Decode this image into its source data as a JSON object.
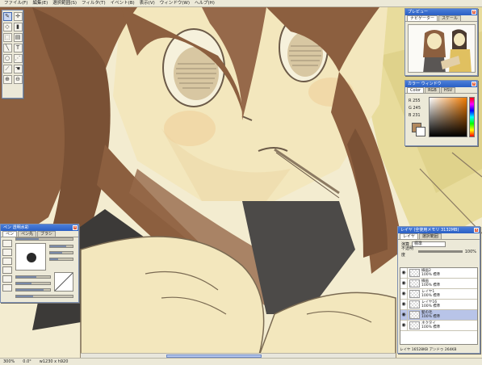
{
  "menu": {
    "items": [
      "ファイル(F)",
      "編集(E)",
      "選択範囲(S)",
      "フィルタ(T)",
      "イベント(B)",
      "表示(V)",
      "ウィンドウ(W)",
      "ヘルプ(H)"
    ]
  },
  "toolbox": {
    "tools": [
      {
        "name": "pen-tool-icon",
        "glyph": "✎"
      },
      {
        "name": "move-tool-icon",
        "glyph": "✛"
      },
      {
        "name": "eraser-tool-icon",
        "glyph": "◇"
      },
      {
        "name": "fill-tool-icon",
        "glyph": "▮"
      },
      {
        "name": "select-tool-icon",
        "glyph": "⬚"
      },
      {
        "name": "gradient-tool-icon",
        "glyph": "▤"
      },
      {
        "name": "line-tool-icon",
        "glyph": "╲"
      },
      {
        "name": "text-tool-icon",
        "glyph": "T"
      },
      {
        "name": "lasso-tool-icon",
        "glyph": "○"
      },
      {
        "name": "magic-wand-icon",
        "glyph": "⋰"
      },
      {
        "name": "eyedropper-icon",
        "glyph": "⟋"
      },
      {
        "name": "hand-tool-icon",
        "glyph": "☚"
      },
      {
        "name": "zoom-in-icon",
        "glyph": "⊕"
      },
      {
        "name": "zoom-out-icon",
        "glyph": "⊖"
      }
    ]
  },
  "preview": {
    "title": "プレビュー",
    "tabs": [
      "ナビゲーター",
      "スケール"
    ]
  },
  "color_window": {
    "title": "カラー ウィンドウ",
    "tabs": [
      "Color",
      "RGB",
      "HSV"
    ],
    "r_label": "R 255",
    "g_label": "G 245",
    "b_label": "B 231",
    "foreground": "#b2895e",
    "background": "#ffffff"
  },
  "pen_window": {
    "title": "ペン 透明水彩",
    "tabs": [
      "ペン",
      "ペン先",
      "ブラシ"
    ]
  },
  "layer_window": {
    "title": "レイヤ (全使用メモリ 3132MB)",
    "tabs": [
      "レイヤ",
      "選択範囲"
    ],
    "mode_label": "演算",
    "mode_value": "標準",
    "opacity_label": "不透明度",
    "opacity_value": "100%",
    "layers": [
      {
        "name": "線画2",
        "info": "100% 標準",
        "selected": false
      },
      {
        "name": "線画",
        "info": "100% 標準",
        "selected": false
      },
      {
        "name": "レイヤ1",
        "info": "100% 標準",
        "selected": false
      },
      {
        "name": "レイヤ16",
        "info": "100% 標準",
        "selected": false
      },
      {
        "name": "髪の毛",
        "info": "100% 標準",
        "selected": true
      },
      {
        "name": "ネクタイ",
        "info": "100% 標準",
        "selected": false
      }
    ],
    "status": "レイヤ 16528KB アンドゥ 264KB"
  },
  "statusbar": {
    "zoom": "300%",
    "angle": "0.0°",
    "size": "w1230 x h920"
  },
  "colors": {
    "hair": "#8c5f3f",
    "skin": "#f3e7bd",
    "titlebar": "#2a5fc4"
  }
}
